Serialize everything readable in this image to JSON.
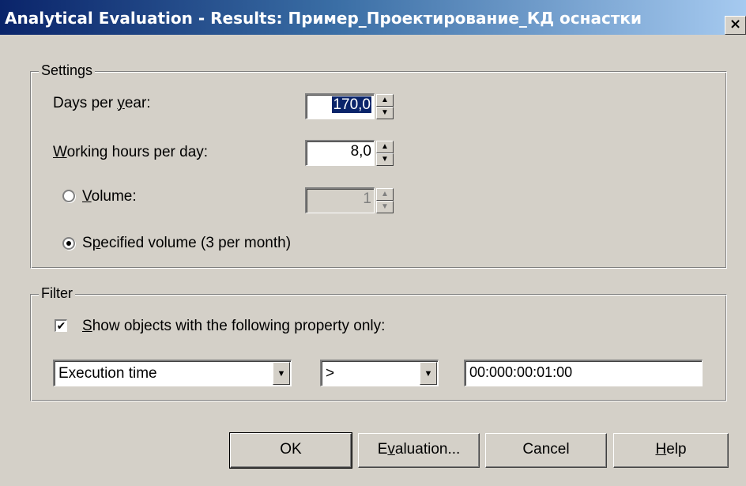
{
  "window": {
    "title": "Analytical Evaluation - Results: Пример_Проектирование_КД оснастки",
    "close_glyph": "×"
  },
  "settings": {
    "group_label": "Settings",
    "days_per_year": {
      "label_pre": "Days per ",
      "label_accel": "y",
      "label_post": "ear:",
      "value": "170,0"
    },
    "working_hours": {
      "label_pre": "",
      "label_accel": "W",
      "label_post": "orking hours per day:",
      "value": "8,0"
    },
    "volume": {
      "label_pre": "",
      "label_accel": "V",
      "label_post": "olume:",
      "value": "1",
      "selected": false
    },
    "specified_volume": {
      "label_pre": "S",
      "label_accel": "p",
      "label_post": "ecified volume (3 per month)",
      "selected": true
    }
  },
  "filter": {
    "group_label": "Filter",
    "show_only": {
      "label_pre": "",
      "label_accel": "S",
      "label_post": "how objects with the following property only:",
      "checked": true
    },
    "property_select": "Execution time",
    "operator_select": ">",
    "value": "00:000:00:01:00"
  },
  "buttons": {
    "ok": "OK",
    "evaluation_pre": "E",
    "evaluation_accel": "v",
    "evaluation_post": "aluation...",
    "cancel": "Cancel",
    "help_accel": "H",
    "help_post": "elp"
  },
  "icons": {
    "spin_up": "▲",
    "spin_down": "▼",
    "dropdown": "▼",
    "check": "✔"
  }
}
